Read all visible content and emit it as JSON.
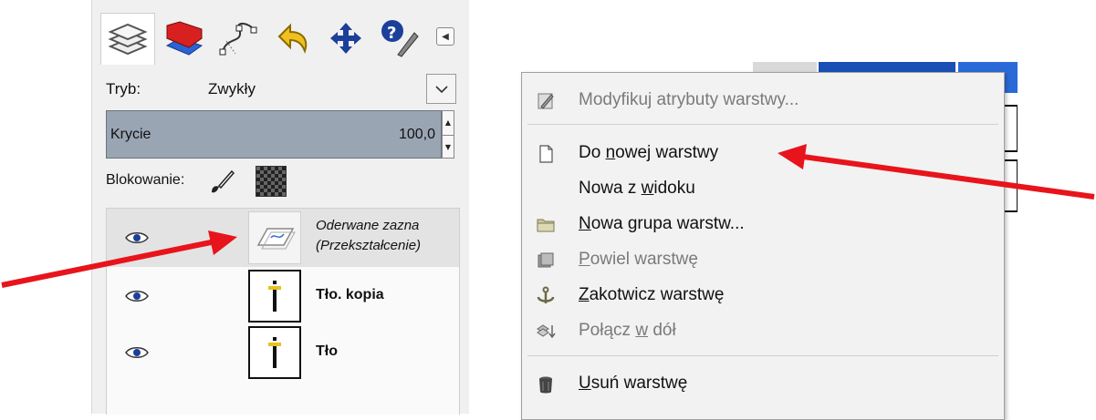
{
  "dock": {
    "mode_label": "Tryb:",
    "mode_value": "Zwykły",
    "opacity_label": "Krycie",
    "opacity_value": "100,0",
    "lock_label": "Blokowanie:",
    "layers": [
      {
        "name_line1": "Oderwane zazna",
        "name_line2": "(Przekształcenie)",
        "selected": true
      },
      {
        "name": "Tło. kopia"
      },
      {
        "name": "Tło"
      }
    ]
  },
  "menu": {
    "items": [
      {
        "pre": "Modyfikuj atrybuty warstwy...",
        "u": "",
        "post": "",
        "disabled": true,
        "icon": "edit-attributes-icon"
      },
      {
        "pre": "Do ",
        "u": "n",
        "post": "owej warstwy",
        "disabled": false,
        "icon": "new-layer-icon"
      },
      {
        "pre": "Nowa z ",
        "u": "w",
        "post": "idoku",
        "disabled": false,
        "icon": ""
      },
      {
        "pre": "",
        "u": "N",
        "post": "owa grupa warstw...",
        "disabled": false,
        "icon": "folder-icon"
      },
      {
        "pre": "",
        "u": "P",
        "post": "owiel warstwę",
        "disabled": true,
        "icon": "duplicate-icon"
      },
      {
        "pre": "",
        "u": "Z",
        "post": "akotwicz warstwę",
        "disabled": false,
        "icon": "anchor-icon"
      },
      {
        "pre": "Połącz ",
        "u": "w",
        "post": " dół",
        "disabled": true,
        "icon": "merge-down-icon"
      },
      {
        "pre": "",
        "u": "U",
        "post": "suń warstwę",
        "disabled": false,
        "icon": "trash-icon"
      }
    ]
  },
  "colors": {
    "annotation_arrow": "#e8141b",
    "opacity_bar": "#9aa5b4"
  }
}
